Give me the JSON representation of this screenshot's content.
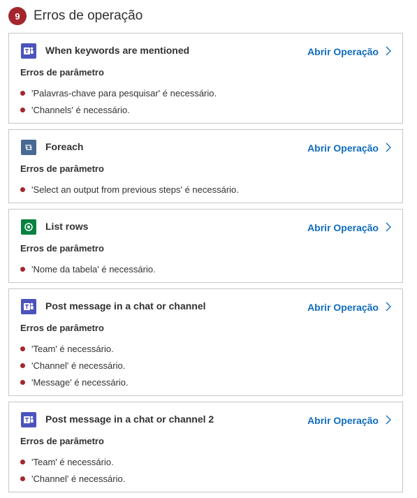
{
  "header": {
    "count": "9",
    "title": "Erros de operação"
  },
  "colors": {
    "error_red": "#a4262c",
    "link_blue": "#0f6cbd",
    "teams_purple": "#4b53bc",
    "foreach_blue": "#486991",
    "dataverse_green": "#088142"
  },
  "operations": [
    {
      "name": "When keywords are mentioned",
      "icon": "teams-icon",
      "link": "Abrir Operação",
      "section": "Erros de parâmetro",
      "errors": [
        "'Palavras-chave para pesquisar' é necessário.",
        "'Channels' é necessário."
      ]
    },
    {
      "name": "Foreach",
      "icon": "loop-icon",
      "link": "Abrir Operação",
      "section": "Erros de parâmetro",
      "errors": [
        "'Select an output from previous steps' é necessário."
      ]
    },
    {
      "name": "List rows",
      "icon": "dataverse-icon",
      "link": "Abrir Operação",
      "section": "Erros de parâmetro",
      "errors": [
        "'Nome da tabela' é necessário."
      ]
    },
    {
      "name": "Post message in a chat or channel",
      "icon": "teams-icon",
      "link": "Abrir Operação",
      "section": "Erros de parâmetro",
      "errors": [
        "'Team' é necessário.",
        "'Channel' é necessário.",
        "'Message' é necessário."
      ]
    },
    {
      "name": "Post message in a chat or channel 2",
      "icon": "teams-icon",
      "link": "Abrir Operação",
      "section": "Erros de parâmetro",
      "errors": [
        "'Team' é necessário.",
        "'Channel' é necessário."
      ]
    }
  ]
}
